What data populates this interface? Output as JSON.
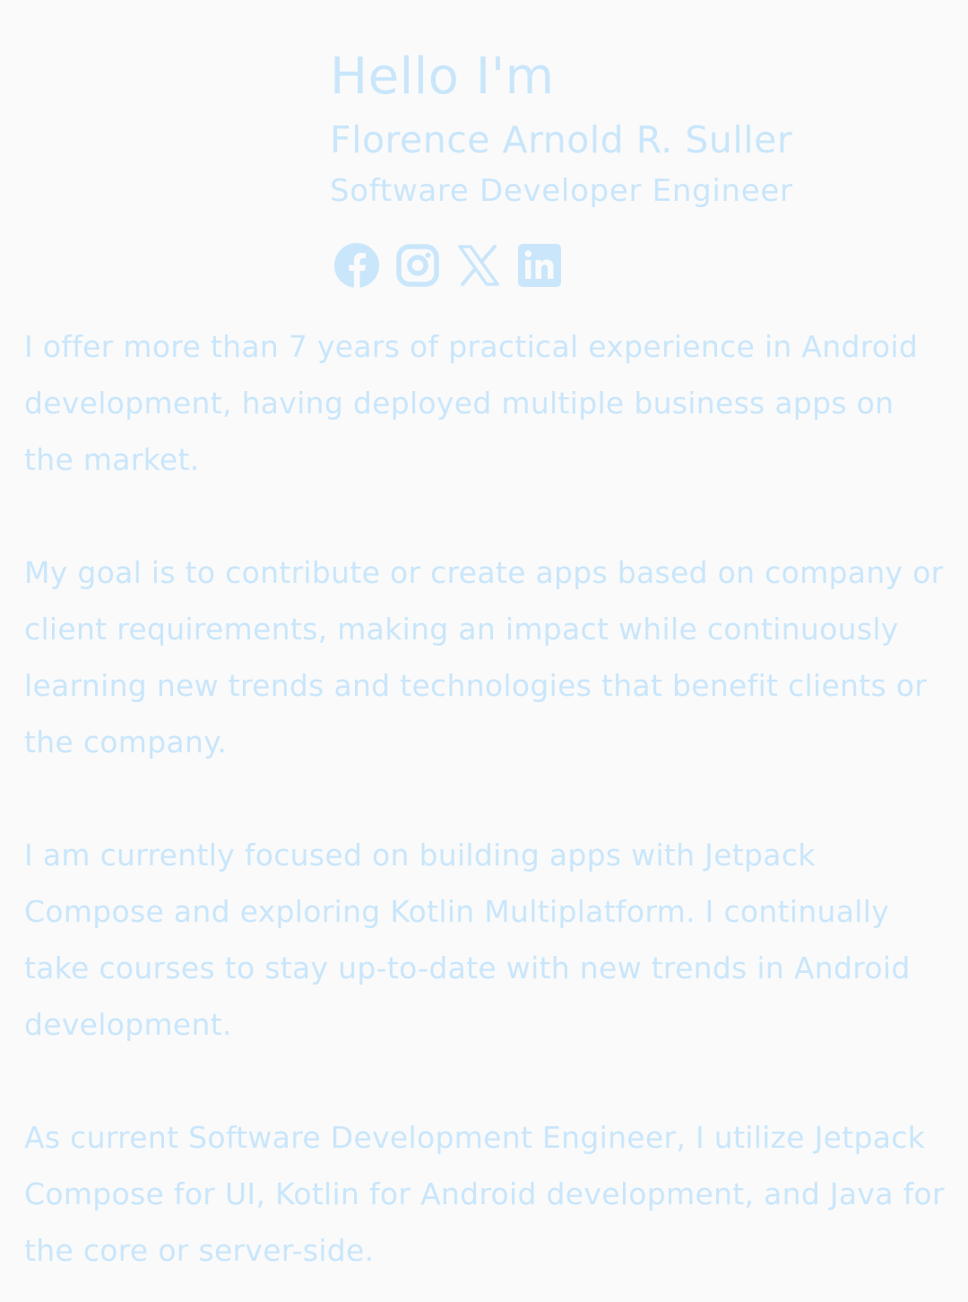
{
  "profile": {
    "greeting": "Hello I'm",
    "name": "Florence Arnold R. Suller",
    "role": "Software Developer Engineer"
  },
  "socials": [
    {
      "icon": "facebook-icon"
    },
    {
      "icon": "instagram-icon"
    },
    {
      "icon": "x-icon"
    },
    {
      "icon": "linkedin-icon"
    }
  ],
  "about": {
    "paragraphs": [
      "I offer more than 7 years of practical experience in Android development, having deployed multiple business apps on the market.",
      "My goal is to contribute or create apps based on company or client requirements, making an impact while continuously learning new trends and technologies that benefit clients or the company.",
      "I am currently focused on building apps with Jetpack Compose and exploring Kotlin Multiplatform. I continually take courses to stay up-to-date with new trends in Android development.",
      "As current Software Development Engineer, I utilize Jetpack Compose for UI, Kotlin for Android development, and Java for the core or server-side."
    ]
  },
  "colors": {
    "background": "#fafafa",
    "text": "#c9e6fb"
  }
}
